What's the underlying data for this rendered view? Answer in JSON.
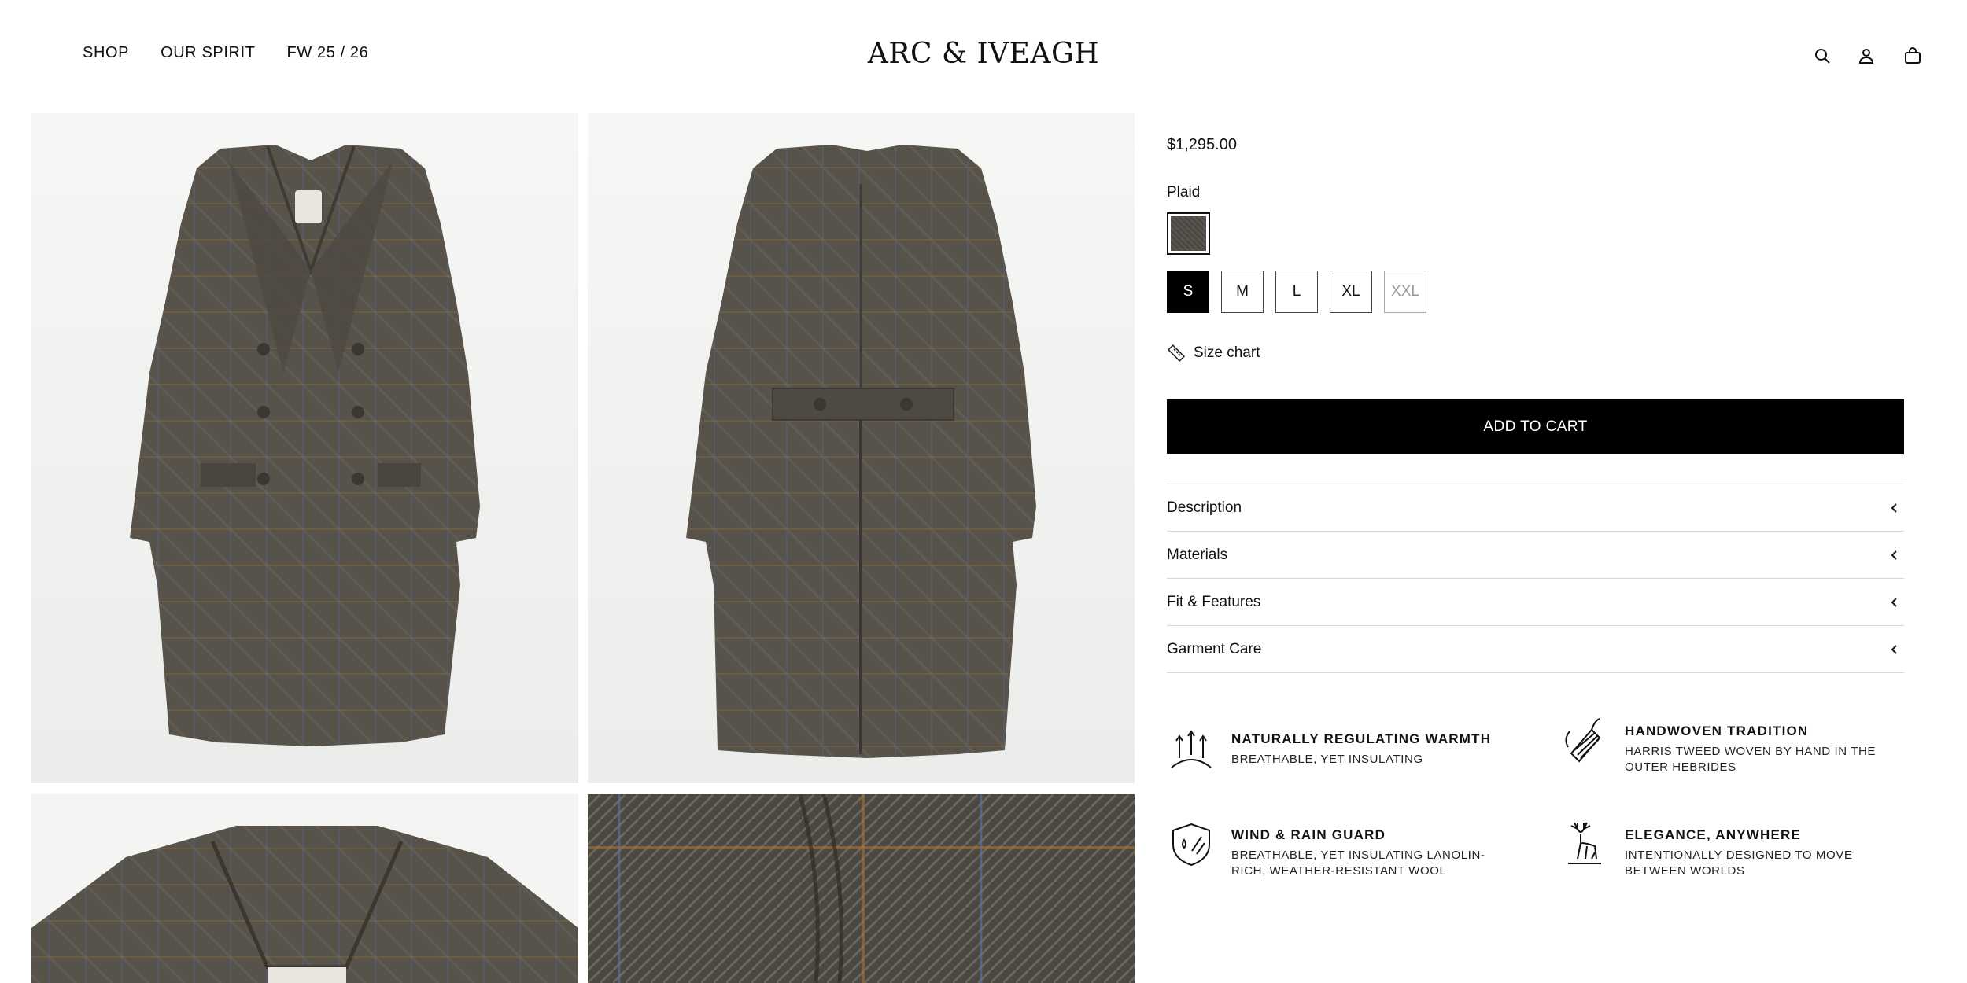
{
  "header": {
    "nav": [
      "SHOP",
      "OUR SPIRIT",
      "FW 25 / 26"
    ],
    "logo": "ARC & IVEAGH",
    "icons": [
      "search-icon",
      "account-icon",
      "cart-icon"
    ]
  },
  "gallery": {
    "images": [
      "coat-front",
      "coat-back",
      "coat-collar-detail",
      "tweed-fabric-detail"
    ]
  },
  "product": {
    "price": "$1,295.00",
    "color_label": "Plaid",
    "sizes": [
      "S",
      "M",
      "L",
      "XL",
      "XXL"
    ],
    "selected_size": "S",
    "unavailable_sizes": [
      "XXL"
    ],
    "size_chart_label": "Size chart",
    "add_to_cart_label": "ADD TO CART",
    "accordion": [
      "Description",
      "Materials",
      "Fit & Features",
      "Garment Care"
    ]
  },
  "features": [
    {
      "title": "NATURALLY REGULATING WARMTH",
      "subtitle": "BREATHABLE, YET INSULATING",
      "icon": "warmth-icon"
    },
    {
      "title": "HANDWOVEN TRADITION",
      "subtitle": "HARRIS TWEED WOVEN BY HAND IN THE OUTER HEBRIDES",
      "icon": "spool-icon"
    },
    {
      "title": "WIND & RAIN GUARD",
      "subtitle": "BREATHABLE, YET INSULATING LANOLIN-RICH, WEATHER-RESISTANT WOOL",
      "icon": "shield-rain-icon"
    },
    {
      "title": "ELEGANCE, ANYWHERE",
      "subtitle": "INTENTIONALLY DESIGNED TO MOVE BETWEEN WORLDS",
      "icon": "stag-icon"
    }
  ],
  "colors": {
    "text": "#111111",
    "button": "#000000",
    "divider": "#d6d6d6",
    "tweed": "#4b4741"
  }
}
